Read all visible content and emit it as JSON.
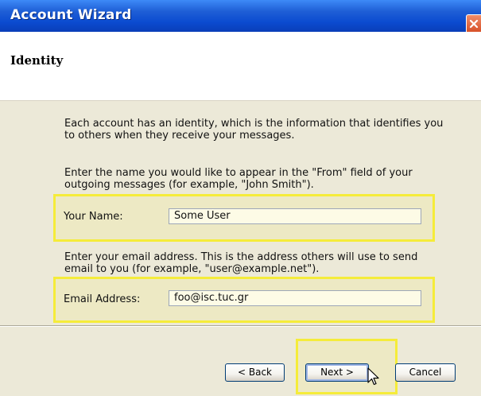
{
  "window": {
    "title": "Account Wizard"
  },
  "header": {
    "title": "Identity"
  },
  "body": {
    "intro": "Each account has an identity, which is the information that identifies you to others when they receive your messages.",
    "name_instruction": "Enter the name you would like to appear in the \"From\" field of your outgoing messages (for example, \"John Smith\").",
    "email_instruction": "Enter your email address. This is the address others will use to send email to you (for example, \"user@example.net\")."
  },
  "fields": {
    "name_label": "Your Name:",
    "name_value": "Some User",
    "email_label": "Email Address:",
    "email_value": "foo@isc.tuc.gr"
  },
  "buttons": {
    "back": "< Back",
    "next": "Next >",
    "cancel": "Cancel"
  },
  "colors": {
    "highlight": "#f5ec3a",
    "titlebar": "#0b4bd0",
    "dialog_bg": "#ece9d8"
  },
  "icons": {
    "close": "close-icon",
    "cursor": "mouse-pointer-icon"
  }
}
